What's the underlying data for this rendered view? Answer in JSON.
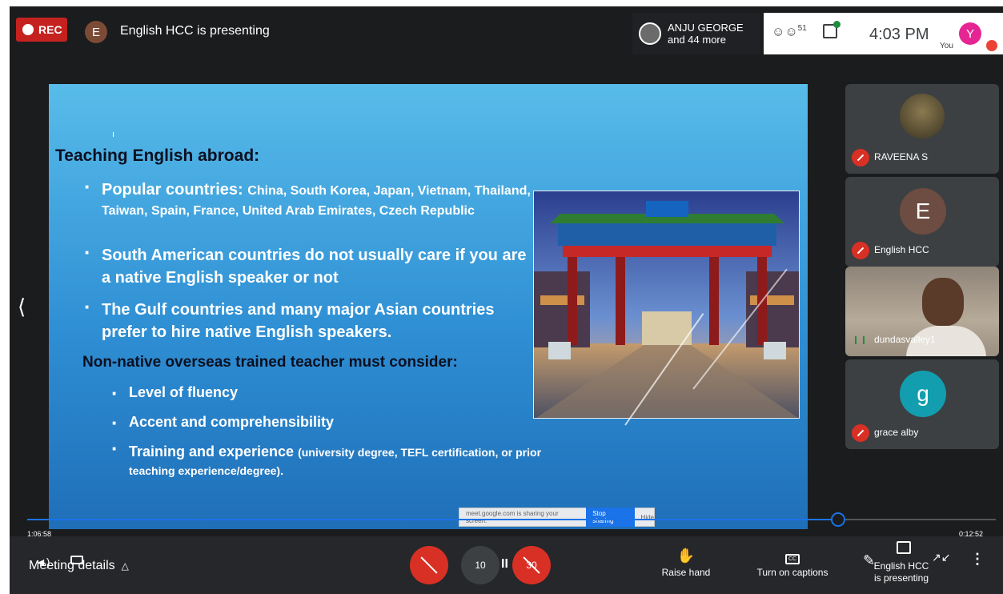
{
  "topbar": {
    "rec_label": "REC",
    "presenter_initial": "E",
    "presenting_text": "English HCC is presenting",
    "participants_line1": "ANJU GEORGE",
    "participants_line2": "and 44 more",
    "people_count": "51",
    "time": "4:03 PM",
    "you_label": "You",
    "you_initial": "Y"
  },
  "slide": {
    "title": "Teaching English abroad:",
    "bullet1_head": "Popular countries:",
    "bullet1_body": "China, South Korea, Japan, Vietnam, Thailand, Taiwan, Spain, France, United Arab Emirates, Czech Republic",
    "bullet2": "South American countries do not usually care if you are a native English speaker or not",
    "bullet3": "The Gulf countries and many major Asian countries prefer to hire native English speakers.",
    "subheading": "Non-native overseas trained teacher must consider:",
    "sub_bullet1": "Level of fluency",
    "sub_bullet2": "Accent and comprehensibility",
    "sub_bullet3_head": "Training and experience",
    "sub_bullet3_body": "(university degree, TEFL certification, or prior teaching experience/degree)."
  },
  "share_banner": {
    "text": "meet.google.com is sharing your screen.",
    "stop_label": "Stop sharing",
    "hide_label": "Hide"
  },
  "tiles": [
    {
      "name": "RAVEENA S",
      "initial": ""
    },
    {
      "name": "English HCC",
      "initial": "E"
    },
    {
      "name": "dundasvalley1",
      "initial": ""
    },
    {
      "name": "grace alby",
      "initial": "g"
    }
  ],
  "player": {
    "elapsed": "1:06:58",
    "remaining": "0:12:52",
    "progress": 0.837,
    "skip_back": "10",
    "skip_fwd": "30"
  },
  "bottombar": {
    "meeting_details": "Meeting details",
    "raise_hand": "Raise hand",
    "captions": "Turn on captions",
    "presenting_line1": "English HCC",
    "presenting_line2": "is presenting"
  },
  "colors": {
    "record_red": "#c5221f",
    "mute_red": "#d93025",
    "accent_blue": "#1a73e8",
    "meet_dark": "#1b1c1e"
  }
}
